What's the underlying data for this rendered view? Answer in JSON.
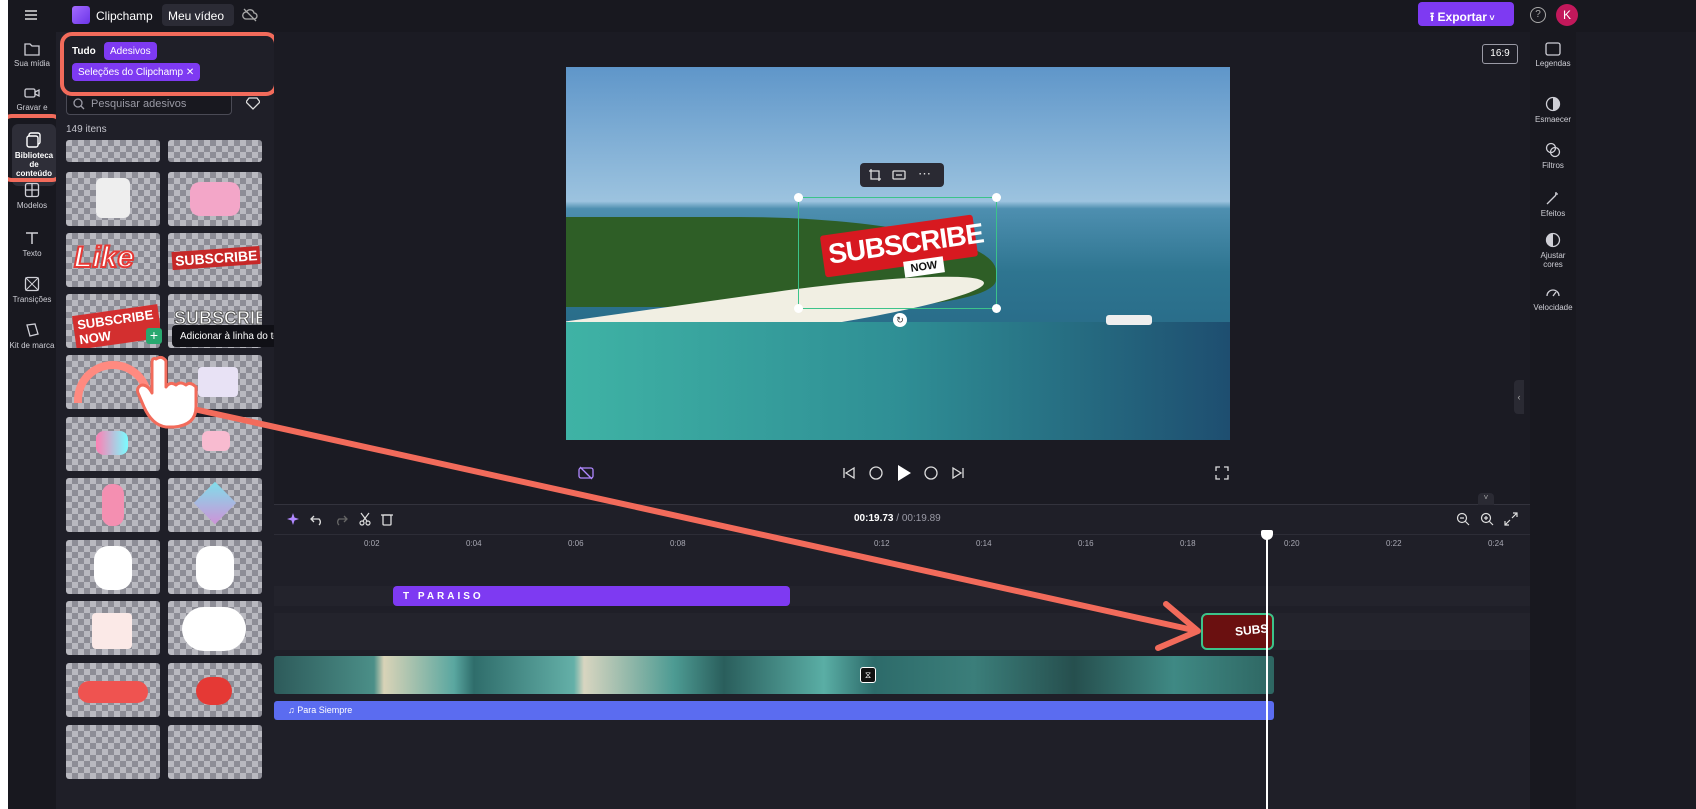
{
  "app": {
    "brand": "Clipchamp",
    "project_tab": "Meu vídeo",
    "export_label": "Exportar",
    "help": "?",
    "avatar_initial": "K"
  },
  "rail": [
    {
      "label": "Sua mídia"
    },
    {
      "label": "Gravar e"
    },
    {
      "label": "Biblioteca de conteúdo"
    },
    {
      "label": "Modelos"
    },
    {
      "label": "Texto"
    },
    {
      "label": "Transições"
    },
    {
      "label": "Kit de marca"
    }
  ],
  "library": {
    "tab_all": "Tudo",
    "tab_stickers": "Adesivos",
    "filter_chip": "Seleções do Clipchamp",
    "search_placeholder": "Pesquisar adesivos",
    "count": "149 itens",
    "stickers": [
      "Like",
      "SUBSCRIBE",
      "SUBSCRIBE NOW",
      "SUBSCRIBE"
    ],
    "tooltip": "Adicionar à linha do tempo"
  },
  "preview": {
    "aspect_ratio": "16:9",
    "sticker_main": "SUBSCRIBE",
    "sticker_sub": "NOW"
  },
  "right_rail": [
    {
      "label": "Legendas"
    },
    {
      "label": "Esmaecer"
    },
    {
      "label": "Filtros"
    },
    {
      "label": "Efeitos"
    },
    {
      "label": "Ajustar cores"
    },
    {
      "label": "Velocidade"
    }
  ],
  "timeline": {
    "current_time": "00:19.73",
    "total_time": " / 00:19.89",
    "ticks": [
      "0:02",
      "0:04",
      "0:06",
      "0:08",
      "0:12",
      "0:14",
      "0:16",
      "0:18",
      "0:20",
      "0:22",
      "0:24"
    ],
    "text_clip": "PARAISO",
    "audio_clip": "Para Siempre",
    "sticker_clip": "SUBS"
  },
  "colors": {
    "accent": "#7e3af2",
    "highlight": "#f26b5b",
    "selection": "#3cc38a"
  }
}
